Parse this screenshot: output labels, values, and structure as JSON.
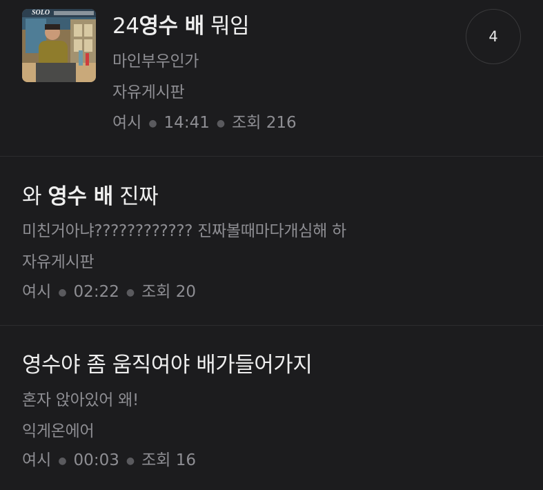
{
  "posts": [
    {
      "title_pre": "24",
      "title_bold": "영수 배",
      "title_post": " 뭐임",
      "author": "마인부우인가",
      "board": "자유게시판",
      "meta_user": "여시",
      "meta_time": "14:41",
      "meta_views": "조회 216",
      "comment_count": "4",
      "thumbnail_caption": "SOLO"
    },
    {
      "title_pre": "와 ",
      "title_bold": "영수 배",
      "title_post": " 진짜",
      "excerpt": "미친거아냐???????????? 진짜볼때마다개심해 하",
      "board": "자유게시판",
      "meta_user": "여시",
      "meta_time": "02:22",
      "meta_views": "조회 20"
    },
    {
      "title": "영수야 좀 움직여야 배가들어가지",
      "excerpt": "혼자 앉아있어 왜!",
      "board": "익게온에어",
      "meta_user": "여시",
      "meta_time": "00:03",
      "meta_views": "조회 16"
    }
  ],
  "colors": {
    "background": "#1c1c1e",
    "title": "#eeeeee",
    "secondary": "#8e8e93",
    "divider": "#2c2c2e"
  }
}
